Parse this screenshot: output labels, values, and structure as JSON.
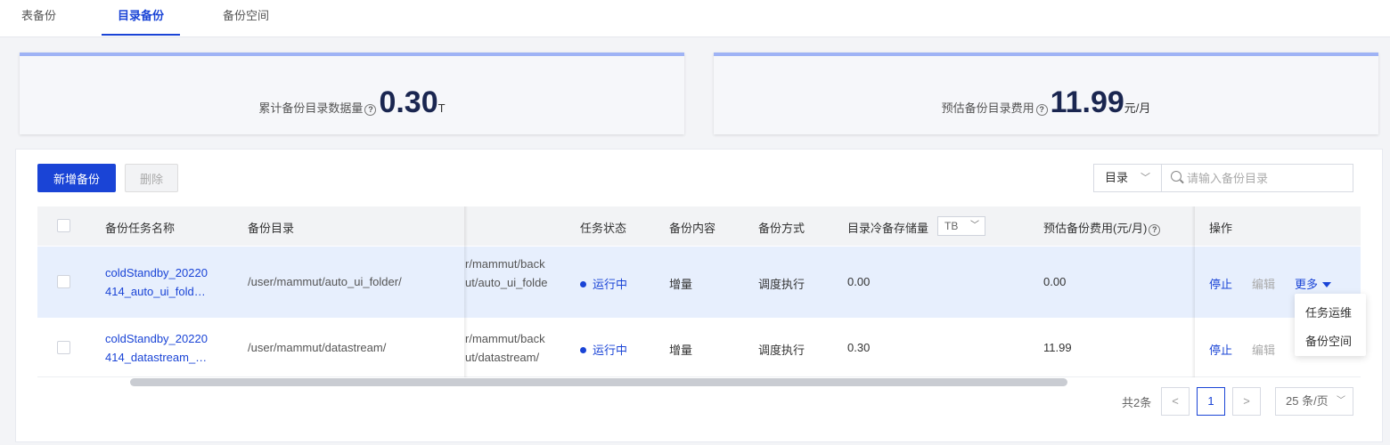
{
  "tabs": [
    {
      "label": "表备份"
    },
    {
      "label": "目录备份",
      "active": true
    },
    {
      "label": "备份空间"
    }
  ],
  "stats": {
    "total": {
      "label": "累计备份目录数据量",
      "value": "0.30",
      "unit": "T"
    },
    "cost": {
      "label": "预估备份目录费用",
      "value": "11.99",
      "unit": "元/月"
    }
  },
  "toolbar": {
    "add_label": "新增备份",
    "delete_label": "删除"
  },
  "filter": {
    "select_value": "目录",
    "search_placeholder": "请输入备份目录"
  },
  "table": {
    "headers": {
      "name": "备份任务名称",
      "dir": "备份目录",
      "status": "任务状态",
      "content": "备份内容",
      "method": "备份方式",
      "storage": "目录冷备存储量",
      "storage_unit": "TB",
      "cost": "预估备份费用(元/月)",
      "ops": "操作"
    },
    "rows": [
      {
        "name_line1": "coldStandby_20220",
        "name_line2": "414_auto_ui_fold…",
        "dir": "/user/mammut/auto_ui_folder/",
        "target_line1": "r/mammut/back",
        "target_line2": "ut/auto_ui_folde",
        "status": "运行中",
        "content": "增量",
        "method": "调度执行",
        "storage": "0.00",
        "cost": "0.00"
      },
      {
        "name_line1": "coldStandby_20220",
        "name_line2": "414_datastream_…",
        "dir": "/user/mammut/datastream/",
        "target_line1": "r/mammut/back",
        "target_line2": "ut/datastream/",
        "status": "运行中",
        "content": "增量",
        "method": "调度执行",
        "storage": "0.30",
        "cost": "11.99"
      }
    ],
    "ops": {
      "stop": "停止",
      "edit": "编辑",
      "more": "更多"
    }
  },
  "more_menu": [
    "任务运维",
    "备份空间"
  ],
  "pagination": {
    "total": "共2条",
    "current": "1",
    "page_size": "25 条/页"
  },
  "icons": {
    "help": "help-circle-icon",
    "search": "search-icon",
    "chevron": "chevron-down-icon",
    "prev": "chevron-left-icon",
    "next": "chevron-right-icon"
  },
  "colors": {
    "primary": "#1a44d6",
    "selected_row": "#e7effd",
    "header_bg": "#f2f3f5"
  }
}
